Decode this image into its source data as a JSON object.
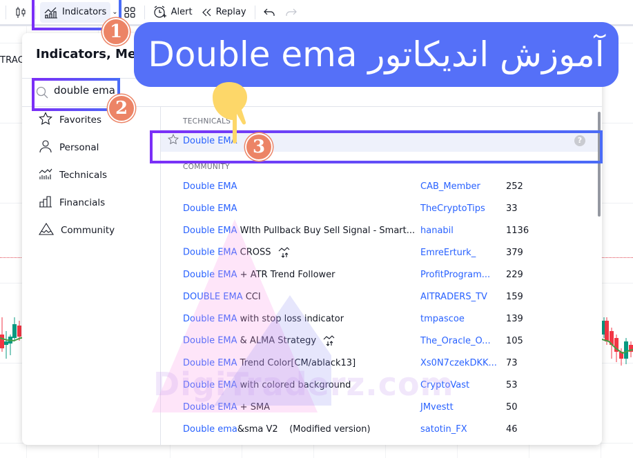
{
  "toolbar": {
    "indicators_label": "Indicators",
    "alert_label": "Alert",
    "replay_label": "Replay",
    "icons": [
      "candlestick-icon",
      "indicators-chart-icon",
      "chevron-down-icon",
      "layout-grid-icon",
      "alarm-clock-plus-icon",
      "replay-rewind-icon",
      "undo-icon",
      "redo-icon"
    ]
  },
  "chart": {
    "left_label": "TRAC",
    "candle_up_color": "#089981",
    "candle_down_color": "#f23645",
    "ema_color": "#43a047"
  },
  "dialog": {
    "title": "Indicators, Metrics & Strategies",
    "title_visible": "Indicators, Metr",
    "search": {
      "value": "double ema",
      "placeholder": "Search"
    },
    "sidebar": [
      {
        "label": "Favorites",
        "icon": "star-icon"
      },
      {
        "label": "Personal",
        "icon": "user-icon"
      },
      {
        "label": "Technicals",
        "icon": "technicals-icon"
      },
      {
        "label": "Financials",
        "icon": "bar-chart-icon"
      },
      {
        "label": "Community",
        "icon": "community-icon"
      }
    ],
    "technicals_header": "TECHNICALS",
    "technicals": [
      {
        "name": "Double EMA",
        "icon": "star-icon",
        "help": "?"
      }
    ],
    "community_header": "COMMUNITY",
    "community": [
      {
        "match": "Double EMA",
        "rest": "",
        "author": "CAB_Member",
        "count": "252",
        "strategy": false
      },
      {
        "match": "Double EMA",
        "rest": "",
        "author": "TheCryptoTips",
        "count": "33",
        "strategy": false
      },
      {
        "match": "Double EMA",
        "rest": " WIth Pullback Buy Sell Signal - Smart...",
        "author": "hanabil",
        "count": "1136",
        "strategy": false
      },
      {
        "match": "Double EMA",
        "rest": " CROSS",
        "author": "EmreErturk_",
        "count": "379",
        "strategy": true
      },
      {
        "match": "Double EMA",
        "rest": " + ATR Trend Follower",
        "author": "ProfitProgram...",
        "count": "229",
        "strategy": false
      },
      {
        "match": "DOUBLE EMA",
        "rest": " CCI",
        "author": "AITRADERS_TV",
        "count": "159",
        "strategy": false
      },
      {
        "match": "Double EMA",
        "rest": " with stop loss indicator",
        "author": "tmpascoe",
        "count": "139",
        "strategy": false
      },
      {
        "match": "Double EMA",
        "rest": " & ALMA Strategy",
        "author": "The_Oracle_O...",
        "count": "105",
        "strategy": true
      },
      {
        "match": "Double EMA",
        "rest": " Trend Color[CM/ablack13]",
        "author": "Xs0N7czekDKK...",
        "count": "73",
        "strategy": false
      },
      {
        "match": "Double EMA",
        "rest": " with colored background",
        "author": "CryptoVast",
        "count": "53",
        "strategy": false
      },
      {
        "match": "Double EMA",
        "rest": " + SMA",
        "author": "JMvestt",
        "count": "50",
        "strategy": false
      },
      {
        "match": "Double ema",
        "rest": "&sma V2    (Modified version)",
        "author": "satotin_FX",
        "count": "46",
        "strategy": false
      }
    ]
  },
  "overlay": {
    "banner_text": "آموزش اندیکاتور Double ema",
    "banner_color": "#5570f8",
    "steps": [
      "1",
      "2",
      "3"
    ],
    "badge_color": "#ec8466",
    "watermark": "DigiTraderz.com"
  }
}
